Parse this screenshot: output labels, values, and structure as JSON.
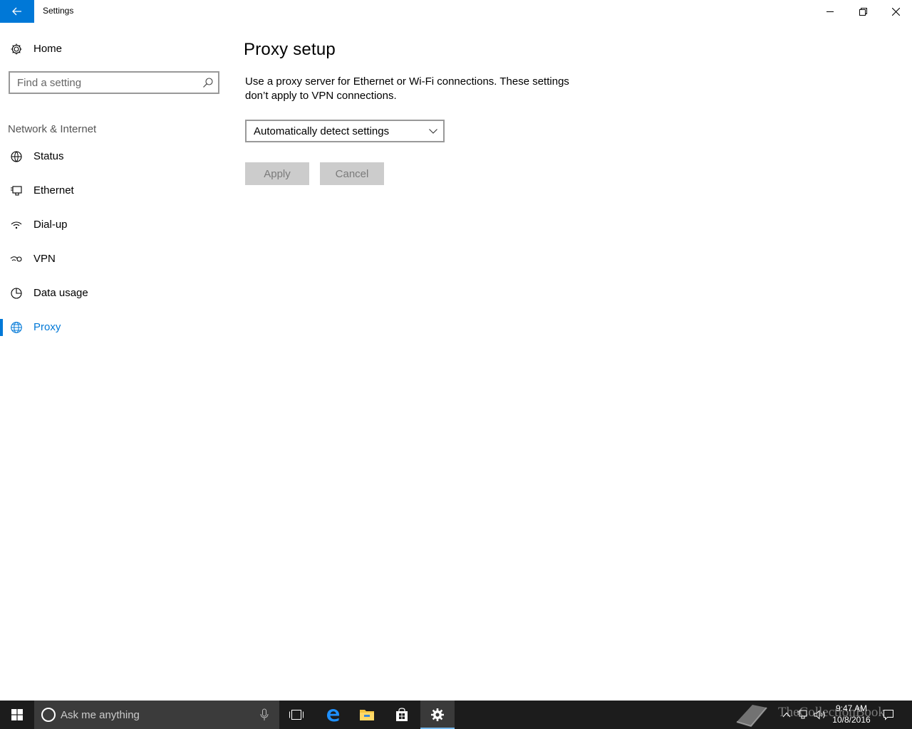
{
  "window": {
    "title": "Settings",
    "back_icon": "back-arrow-icon",
    "accent": "#0078d7"
  },
  "sidebar": {
    "home_label": "Home",
    "search_placeholder": "Find a setting",
    "section_label": "Network & Internet",
    "items": [
      {
        "label": "Status",
        "icon": "status-icon",
        "active": false
      },
      {
        "label": "Ethernet",
        "icon": "ethernet-icon",
        "active": false
      },
      {
        "label": "Dial-up",
        "icon": "dialup-icon",
        "active": false
      },
      {
        "label": "VPN",
        "icon": "vpn-icon",
        "active": false
      },
      {
        "label": "Data usage",
        "icon": "data-usage-icon",
        "active": false
      },
      {
        "label": "Proxy",
        "icon": "globe-icon",
        "active": true
      }
    ]
  },
  "main": {
    "title": "Proxy setup",
    "description": "Use a proxy server for Ethernet or Wi-Fi connections. These settings don’t apply to VPN connections.",
    "dropdown_value": "Automatically detect settings",
    "apply_label": "Apply",
    "cancel_label": "Cancel"
  },
  "taskbar": {
    "search_placeholder": "Ask me anything",
    "time": "9:47 AM",
    "date": "10/8/2016",
    "watermark": "TheCollectionBook"
  }
}
